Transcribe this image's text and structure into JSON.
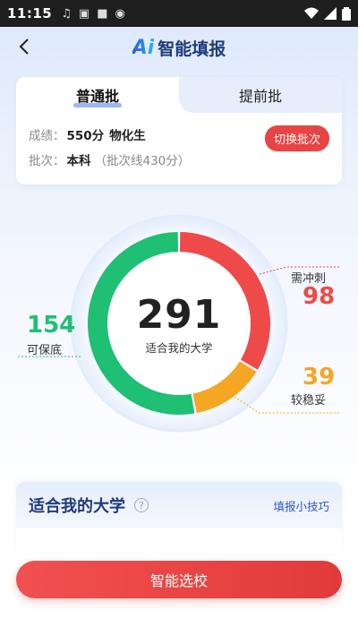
{
  "status": {
    "time": "11:15"
  },
  "nav": {
    "logo": "Ai",
    "title": "智能填报"
  },
  "tabs": [
    {
      "label": "普通批"
    },
    {
      "label": "提前批"
    }
  ],
  "score": {
    "label": "成绩：",
    "value": "550分",
    "subjects": "物化生"
  },
  "batch": {
    "label": "批次：",
    "value": "本科",
    "note": "（批次线430分）"
  },
  "switch_button": "切换批次",
  "summary": {
    "total": "291",
    "total_caption": "适合我的大学",
    "safe": {
      "value": "154",
      "label": "可保底",
      "color": "#1fbf74"
    },
    "reach": {
      "value": "98",
      "label": "需冲刺",
      "color": "#ee4a4a"
    },
    "stable": {
      "value": "39",
      "label": "较稳妥",
      "color": "#f5a623"
    }
  },
  "section": {
    "title": "适合我的大学",
    "help_icon": "question-icon",
    "tips": "填报小技巧"
  },
  "main_button": "智能选校"
}
